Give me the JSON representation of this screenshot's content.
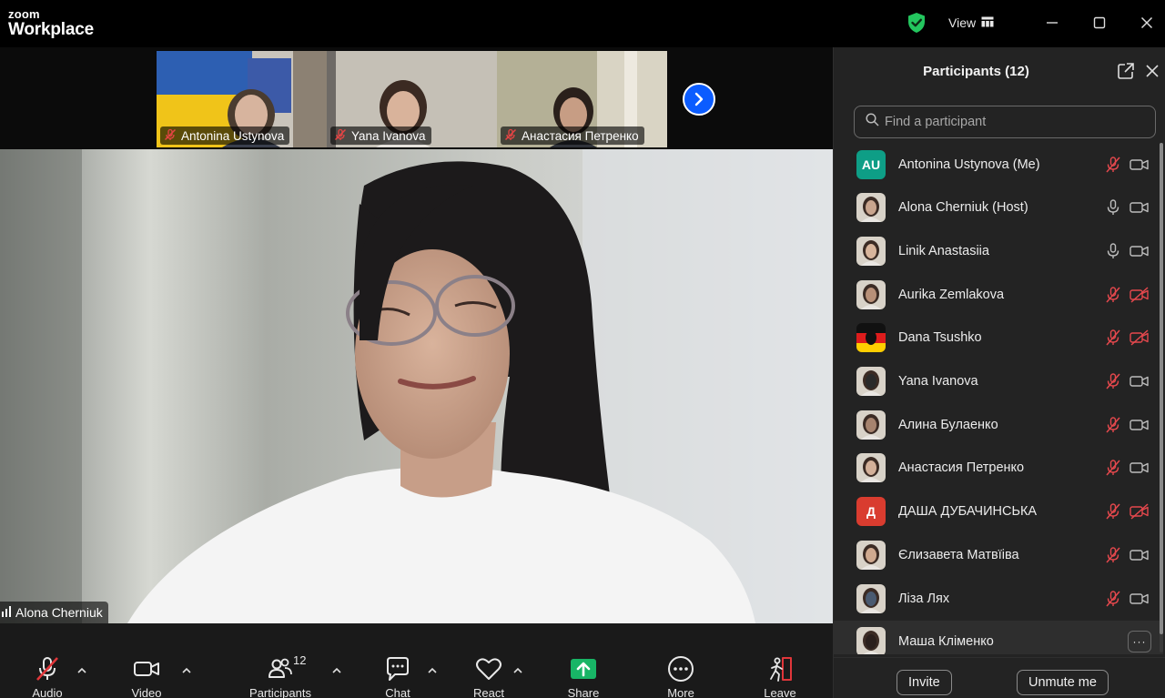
{
  "app": {
    "logo_top": "zoom",
    "logo_bottom": "Workplace",
    "view_label": "View",
    "security_icon": "shield-check-icon"
  },
  "gallery": {
    "thumbnails": [
      {
        "name": "Antonina Ustynova",
        "muted": true
      },
      {
        "name": "Yana Ivanova",
        "muted": true
      },
      {
        "name": "Анастасия Петренко",
        "muted": true
      }
    ]
  },
  "main_video": {
    "speaker_name": "Alona Cherniuk"
  },
  "toolbar": {
    "audio": "Audio",
    "video": "Video",
    "participants": "Participants",
    "participants_count": "12",
    "chat": "Chat",
    "react": "React",
    "share": "Share",
    "more": "More",
    "leave": "Leave"
  },
  "panel": {
    "title": "Participants (12)",
    "search_placeholder": "Find a participant",
    "participants": [
      {
        "name": "Antonina Ustynova (Me)",
        "avatar": "AU",
        "avatar_color": "#0e9e86",
        "mic": "muted",
        "cam": "on"
      },
      {
        "name": "Alona Cherniuk (Host)",
        "avatar": "",
        "mic": "on",
        "cam": "on"
      },
      {
        "name": "Linik Anastasiia",
        "avatar": "",
        "mic": "on",
        "cam": "on"
      },
      {
        "name": "Aurika Zemlakova",
        "avatar": "",
        "mic": "muted",
        "cam": "off"
      },
      {
        "name": "Dana Tsushko",
        "avatar": "",
        "mic": "muted",
        "cam": "off"
      },
      {
        "name": "Yana Ivanova",
        "avatar": "",
        "mic": "muted",
        "cam": "on"
      },
      {
        "name": "Алина Булаенко",
        "avatar": "",
        "mic": "muted",
        "cam": "on"
      },
      {
        "name": "Анастасия Петренко",
        "avatar": "",
        "mic": "muted",
        "cam": "on"
      },
      {
        "name": "ДАША ДУБАЧИНСЬКА",
        "avatar": "Д",
        "avatar_color": "#d93c2f",
        "mic": "muted",
        "cam": "off"
      },
      {
        "name": "Єлизавета Матвїіва",
        "avatar": "",
        "mic": "muted",
        "cam": "on"
      },
      {
        "name": "Ліза Лях",
        "avatar": "",
        "mic": "muted",
        "cam": "on"
      },
      {
        "name": "Маша Кліменко",
        "avatar": "",
        "mic": "",
        "cam": "",
        "more": "···"
      }
    ],
    "invite_label": "Invite",
    "unmute_label": "Unmute me"
  }
}
